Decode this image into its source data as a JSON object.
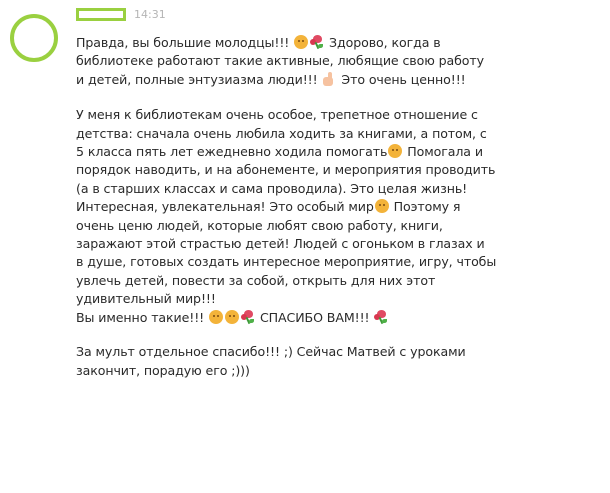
{
  "comment": {
    "avatar_icon": "avatar-placeholder",
    "time": "14:31",
    "paragraphs": [
      [
        "Правда, вы большие молодцы!!! 😉💐 Здорово, когда в",
        "библиотеке работают такие активные, любящие свою работу",
        "и детей, полные энтузиазма люди!!! 👍 Это очень ценно!!!"
      ],
      [
        "У меня к библиотекам очень особое, трепетное отношение с",
        "детства: сначала очень любила ходить за книгами, а потом, с",
        "5 класса пять лет ежедневно ходила помогать😊 Помогала и",
        "порядок наводить, и на абонементе, и мероприятия проводить",
        "(а в старших классах и сама проводила). Это целая жизнь!",
        "Интересная, увлекательная! Это особый мир😊 Поэтому я",
        "очень ценю людей, которые любят свою работу, книги,",
        "заражают этой страстью детей! Людей с огоньком в глазах и",
        "в душе, готовых создать интересное мероприятие, игру, чтобы",
        "увлечь детей, повести за собой, открыть для них этот",
        "удивительный мир!!!",
        "Вы именно такие!!! 😉😊💐 СПАСИБО ВАМ!!! 💐"
      ],
      [
        "За мульт отдельное спасибо!!! ;) Сейчас Матвей с уроками",
        "закончит, порадую его ;)))"
      ]
    ],
    "emoji_icons": {
      "😉": "wink-face-icon",
      "😊": "smile-face-icon",
      "💐": "bouquet-icon",
      "👍": "thumbs-up-icon"
    }
  }
}
